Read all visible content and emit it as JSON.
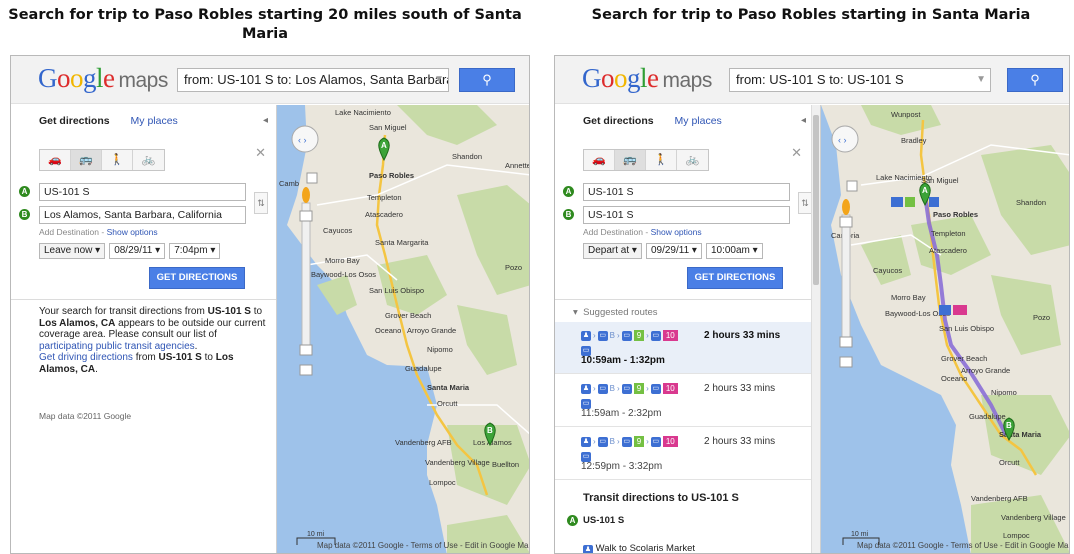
{
  "captions": {
    "left": "Search for trip to Paso Robles starting 20 miles south of Santa Maria",
    "right": "Search for trip to Paso Robles starting in Santa Maria"
  },
  "left": {
    "logo": "Google",
    "logo_suffix": "maps",
    "search_value": "from: US-101 S to: Los Alamos, Santa Barbara",
    "tabs": [
      "Get directions",
      "My places"
    ],
    "origin": "US-101 S",
    "destination": "Los Alamos, Santa Barbara, California",
    "add_destination": "Add Destination",
    "show_options": "Show options",
    "time_mode": "Leave now",
    "date": "08/29/11",
    "time": "7:04pm",
    "get_directions": "GET DIRECTIONS",
    "message": {
      "p1_a": "Your search for transit directions from ",
      "p1_b": "US-101 S",
      "p1_c": " to ",
      "p1_d": "Los Alamos, CA",
      "p1_e": " appears to be outside our current coverage area. Please consult our list of ",
      "p1_link": "participating public transit agencies",
      "p1_end": ".",
      "p2_link": "Get driving directions",
      "p2_a": " from ",
      "p2_b": "US-101 S",
      "p2_c": " to ",
      "p2_d": "Los Alamos, CA",
      "p2_end": "."
    },
    "map_data": "Map data ©2011 Google",
    "footer": "Map data ©2011 Google - Terms of Use - Edit in Google Maps",
    "scale": "10 mi",
    "map_labels": [
      "Lake Nacimiento",
      "San Miguel",
      "Shandon",
      "Paso Robles",
      "Templeton",
      "Atascadero",
      "Cayucos",
      "Santa Margarita",
      "Morro Bay",
      "Baywood-Los Osos",
      "San Luis Obispo",
      "Grover Beach",
      "Arroyo Grande",
      "Oceano",
      "Nipomo",
      "Guadalupe",
      "Santa Maria",
      "Orcutt",
      "Vandenberg AFB",
      "Vandenberg Village",
      "Lompoc",
      "Los Alamos",
      "Pozo",
      "Buellton",
      "Annette",
      "Camb"
    ]
  },
  "right": {
    "logo": "Google",
    "logo_suffix": "maps",
    "search_value": "from: US-101 S to: US-101 S",
    "tabs": [
      "Get directions",
      "My places"
    ],
    "origin": "US-101 S",
    "destination": "US-101 S",
    "add_destination": "Add Destination",
    "show_options": "Show options",
    "time_mode": "Depart at",
    "date": "09/29/11",
    "time": "10:00am",
    "get_directions": "GET DIRECTIONS",
    "suggested": "Suggested routes",
    "routes": [
      {
        "duration": "2 hours 33 mins",
        "times": "10:59am - 1:32pm"
      },
      {
        "duration": "2 hours 33 mins",
        "times": "11:59am - 2:32pm"
      },
      {
        "duration": "2 hours 33 mins",
        "times": "12:59pm - 3:32pm"
      }
    ],
    "route_badges": [
      "9",
      "10"
    ],
    "route_b": "B",
    "transit_header": "Transit directions to US-101 S",
    "start_place": "US-101 S",
    "walk": "Walk to Scolaris Market",
    "footer": "Map data ©2011 Google - Terms of Use - Edit in Google Maps",
    "scale": "10 mi",
    "map_labels": [
      "Wunpost",
      "Bradley",
      "Lake Nacimiento",
      "San Miguel",
      "Shandon",
      "Paso Robles",
      "Templeton",
      "Atascadero",
      "Cambria",
      "Cayucos",
      "Morro Bay",
      "Baywood-Los Osos",
      "San Luis Obispo",
      "Pozo",
      "Grover Beach",
      "Arroyo Grande",
      "Oceano",
      "Nipomo",
      "Guadalupe",
      "Santa Maria",
      "Orcutt",
      "Vandenberg AFB",
      "Vandenberg Village",
      "Lompoc"
    ]
  },
  "colors": {
    "accent": "#4a7fe6",
    "link": "#3056b5",
    "route": "#8b6fd6",
    "marker": "#2f8a1f"
  }
}
